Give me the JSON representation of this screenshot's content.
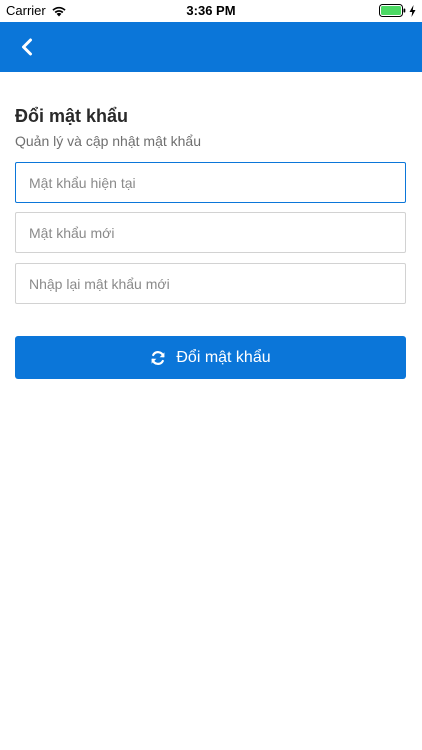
{
  "status_bar": {
    "carrier": "Carrier",
    "time": "3:36 PM"
  },
  "nav": {
    "back_icon": "chevron-left-icon"
  },
  "page": {
    "title": "Đổi mật khẩu",
    "subtitle": "Quản lý và cập nhật mật khẩu"
  },
  "form": {
    "current_password_placeholder": "Mật khẩu hiện tại",
    "new_password_placeholder": "Mật khẩu mới",
    "confirm_password_placeholder": "Nhập lại mật khẩu mới",
    "submit_label": "Đổi mật khẩu",
    "submit_icon": "refresh-icon"
  },
  "colors": {
    "primary": "#0b76d9",
    "battery": "#4cd964"
  }
}
